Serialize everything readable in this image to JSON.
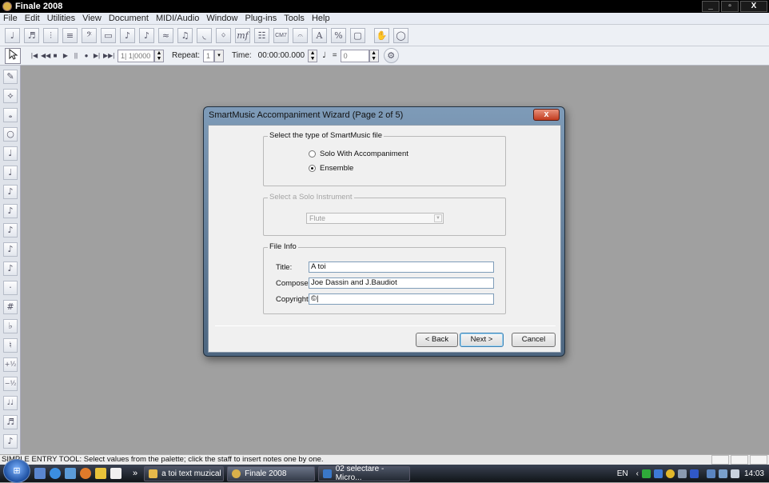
{
  "window": {
    "title": "Finale 2008",
    "icon": "finale-icon",
    "controls": [
      "_",
      "▫",
      "X"
    ]
  },
  "menu": [
    "File",
    "Edit",
    "Utilities",
    "View",
    "Document",
    "MIDI/Audio",
    "Window",
    "Plug-ins",
    "Tools",
    "Help"
  ],
  "toolbar_main": {
    "tools": [
      "♩",
      "♬",
      "⫶",
      "≡",
      "𝄢",
      "▭",
      "♪",
      "♪",
      "≈",
      "♫",
      "◟",
      "ᛜ",
      "mf",
      "☷",
      "CM7",
      "𝄐",
      "A",
      "%",
      "▢",
      "✋",
      "◯"
    ]
  },
  "playback": {
    "buttons": [
      "|◀",
      "◀◀",
      "■",
      "▶",
      "||",
      "●",
      "▶|",
      "▶▶|"
    ],
    "measure_value": "1| 1|0000",
    "repeat_label": "Repeat:",
    "repeat_value": "1",
    "time_label": "Time:",
    "time_value": "00:00:00.000",
    "tempo_equals": "=",
    "tempo_value": "0"
  },
  "palette": [
    "✎",
    "⟡",
    "𝅝",
    "○",
    "♩",
    "♩",
    "♪",
    "♪",
    "♪",
    "♪",
    "♪",
    "·",
    "#",
    "♭",
    "♮",
    "+½",
    "−½",
    "♩♩",
    "♬",
    "♪"
  ],
  "dialog": {
    "title": "SmartMusic Accompaniment Wizard (Page 2 of 5)",
    "close_label": "x",
    "file_type_group": "Select the type of SmartMusic file",
    "options": [
      {
        "label": "Solo With Accompaniment",
        "selected": false
      },
      {
        "label": "Ensemble",
        "selected": true
      }
    ],
    "solo_group": "Select a Solo Instrument",
    "instrument_value": "Flute",
    "file_info_group": "File Info",
    "fields": {
      "title_label": "Title:",
      "title_value": "A toi",
      "composer_label": "Composer:",
      "composer_value": "Joe Dassin and J.Baudiot",
      "copyright_label": "Copyright:",
      "copyright_value": "©|"
    },
    "buttons": {
      "back": "< Back",
      "next": "Next >",
      "cancel": "Cancel"
    }
  },
  "status_text": "SIMPLE ENTRY TOOL: Select values from the palette; click the staff to insert notes one by one.",
  "taskbar": {
    "start_label": "⊞",
    "overflow": "»",
    "tasks": [
      {
        "label": "a toi text muzical",
        "color": "#e6b84a"
      },
      {
        "label": "Finale 2008",
        "color": "#d8b04a"
      },
      {
        "label": "02 selectare - Micro...",
        "color": "#3a78c8"
      }
    ],
    "language": "EN",
    "clock": "14:03"
  },
  "colors": {
    "workspace": "#a0a0a0",
    "dialog_frame": "#6d88a6",
    "close_red": "#c13b1e",
    "taskbar": "#1e2430"
  }
}
